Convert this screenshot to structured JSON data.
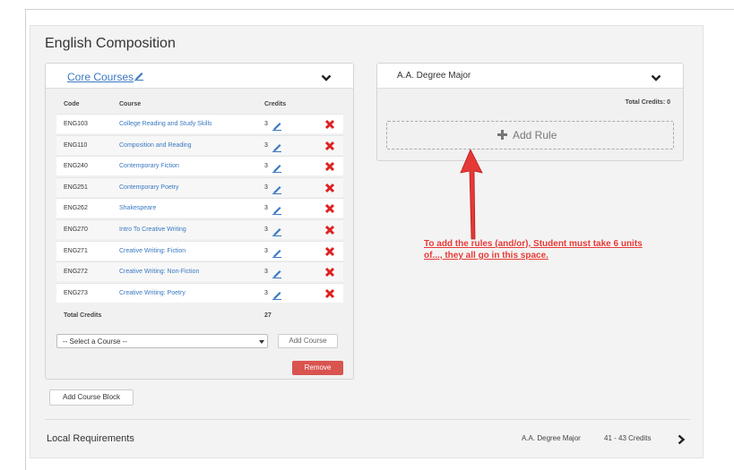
{
  "page": {
    "title": "English Composition"
  },
  "core_block": {
    "title": "Core Courses",
    "headers": {
      "code": "Code",
      "course": "Course",
      "credits": "Credits"
    },
    "rows": [
      {
        "code": "ENG103",
        "course": "College Reading and Study Skills",
        "credits": "3"
      },
      {
        "code": "ENG110",
        "course": "Composition and Reading",
        "credits": "3"
      },
      {
        "code": "ENG240",
        "course": "Contemporary Fiction",
        "credits": "3"
      },
      {
        "code": "ENG251",
        "course": "Contemporary Poetry",
        "credits": "3"
      },
      {
        "code": "ENG262",
        "course": "Shakespeare",
        "credits": "3"
      },
      {
        "code": "ENG270",
        "course": "Intro To Creative Writing",
        "credits": "3"
      },
      {
        "code": "ENG271",
        "course": "Creative Writing: Fiction",
        "credits": "3"
      },
      {
        "code": "ENG272",
        "course": "Creative Writing: Non-Fiction",
        "credits": "3"
      },
      {
        "code": "ENG273",
        "course": "Creative Writing: Poetry",
        "credits": "3"
      }
    ],
    "total_label": "Total Credits",
    "total_value": "27",
    "select_placeholder": "-- Select a Course --",
    "add_course_label": "Add Course",
    "remove_label": "Remove"
  },
  "major_block": {
    "title": "A.A. Degree Major",
    "total_credits": "Total Credits: 0",
    "add_rule_label": "Add Rule"
  },
  "annotation": {
    "text": "To add the rules (and/or), Student must take 6 units of..., they all go in this space."
  },
  "add_block_label": "Add Course Block",
  "local_requirements": {
    "title": "Local Requirements",
    "major": "A.A. Degree Major",
    "credits": "41 - 43 Credits"
  },
  "colors": {
    "link": "#3a78c2",
    "danger": "#d9534f",
    "annotation": "#e53935",
    "delete_x": "#e02020"
  },
  "icons": [
    "pencil-icon",
    "chevron-down-icon",
    "delete-x-icon",
    "plus-icon",
    "chevron-right-icon",
    "red-arrow-icon"
  ]
}
